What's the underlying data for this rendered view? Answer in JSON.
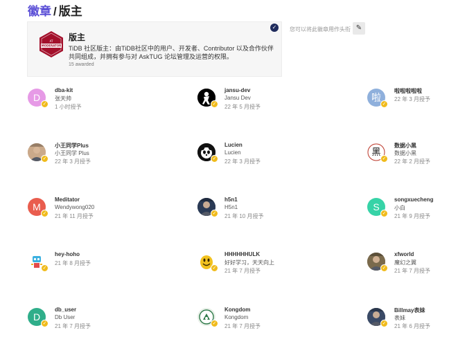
{
  "header": {
    "breadcrumb": "徽章",
    "separator": "/",
    "title": "版主"
  },
  "badge": {
    "title": "版主",
    "description": "TiDB 社区版主：由TiDB社区中的用户、开发者、Contributor 以及合作伙伴共同组成，并拥有参与对 AskTUG 论坛管理及运营的权限。",
    "awarded": "15 awarded",
    "icon": "moderator-badge-icon",
    "icon_text": "MODERATOR",
    "icon_top_text": "AT",
    "brand_color": "#a3102b",
    "check_glyph": "✓"
  },
  "avatar_tip": "您可以将此徽章用作头衔",
  "edit_icon_glyph": "✎",
  "mini_badge_glyph": "✓",
  "mini_badge_color": "#f0bb1c",
  "users": [
    {
      "username": "dba-kit",
      "display": "张天帅",
      "date": "1 小时授予",
      "avatar_letter": "D",
      "avatar_color": "#e69ae6",
      "kind": "letter"
    },
    {
      "username": "jansu-dev",
      "display": "Jansu Dev",
      "date": "22 年 5 月授予",
      "avatar_color": "#000000",
      "kind": "silhouette"
    },
    {
      "username": "啦啦啦啦啦",
      "display": "",
      "date": "22 年 3 月授予",
      "avatar_letter": "啦",
      "avatar_color": "#8fb0dc",
      "kind": "letter"
    },
    {
      "username": "小王同学Plus",
      "display": "小王同学 Plus",
      "date": "22 年 3 月授予",
      "avatar_color": "#caa98a",
      "kind": "photo"
    },
    {
      "username": "Lucien",
      "display": "Lucien",
      "date": "22 年 3 月授予",
      "avatar_color": "#111111",
      "kind": "panda"
    },
    {
      "username": "数据小黑",
      "display": "数据小黑",
      "date": "22 年 2 月授予",
      "avatar_letter": "黑",
      "avatar_color": "#f3f3f3",
      "kind": "glyph"
    },
    {
      "username": "Meditator",
      "display": "Wendywong020",
      "date": "21 年 11 月授予",
      "avatar_letter": "M",
      "avatar_color": "#e95d4e",
      "kind": "letter"
    },
    {
      "username": "h5n1",
      "display": "H5n1",
      "date": "21 年 10 月授予",
      "avatar_color": "#2a3a55",
      "kind": "photo"
    },
    {
      "username": "songxuecheng",
      "display": "小白",
      "date": "21 年 9 月授予",
      "avatar_letter": "S",
      "avatar_color": "#37d3a7",
      "kind": "letter"
    },
    {
      "username": "hey-hoho",
      "display": "",
      "date": "21 年 8 月授予",
      "avatar_color": "#ffffff",
      "kind": "robot"
    },
    {
      "username": "HHHHHHULK",
      "display": "好好学习，天天向上",
      "date": "21 年 7 月授予",
      "avatar_color": "#ffffff",
      "kind": "emoji"
    },
    {
      "username": "xfworld",
      "display": "魔幻之翼",
      "date": "21 年 7 月授予",
      "avatar_color": "#7a6a4c",
      "kind": "photo"
    },
    {
      "username": "db_user",
      "display": "Db User",
      "date": "21 年 7 月授予",
      "avatar_letter": "D",
      "avatar_color": "#2fae8a",
      "kind": "letter"
    },
    {
      "username": "Kongdom",
      "display": "Kongdom",
      "date": "21 年 7 月授予",
      "avatar_color": "#e8f0e8",
      "kind": "logo"
    },
    {
      "username": "Billmay表妹",
      "display": "表妹",
      "date": "21 年 6 月授予",
      "avatar_color": "#3a4a66",
      "kind": "photo"
    }
  ]
}
